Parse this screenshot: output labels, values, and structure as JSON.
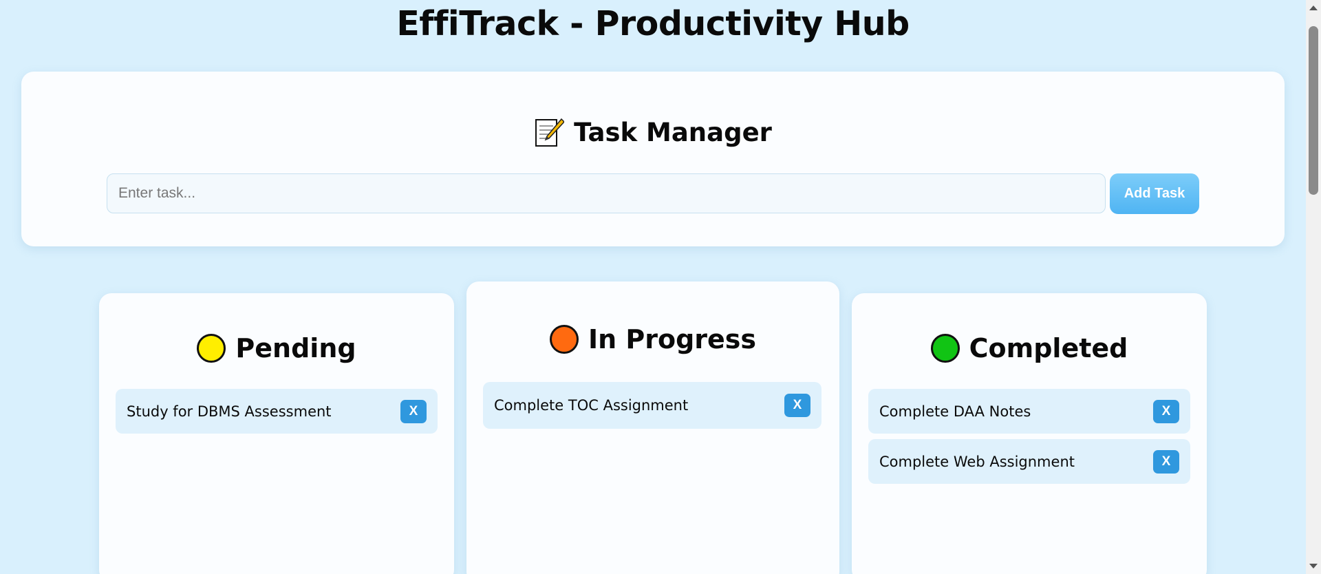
{
  "app": {
    "title": "EffiTrack - Productivity Hub"
  },
  "manager": {
    "heading": "Task Manager",
    "heading_icon": "memo-icon",
    "input_placeholder": "Enter task...",
    "input_value": "",
    "add_label": "Add Task"
  },
  "columns": [
    {
      "title": "Pending",
      "dot_color": "#ffee00",
      "tasks": [
        {
          "text": "Study for DBMS Assessment",
          "delete_label": "X"
        }
      ]
    },
    {
      "title": "In Progress",
      "dot_color": "#ff6a10",
      "tasks": [
        {
          "text": "Complete TOC Assignment",
          "delete_label": "X"
        }
      ]
    },
    {
      "title": "Completed",
      "dot_color": "#11c414",
      "tasks": [
        {
          "text": "Complete DAA Notes",
          "delete_label": "X"
        },
        {
          "text": "Complete Web Assignment",
          "delete_label": "X"
        }
      ]
    }
  ],
  "colors": {
    "accent": "#2f98de",
    "add_button": "#4fb4f3",
    "background": "#d9f0fd"
  }
}
